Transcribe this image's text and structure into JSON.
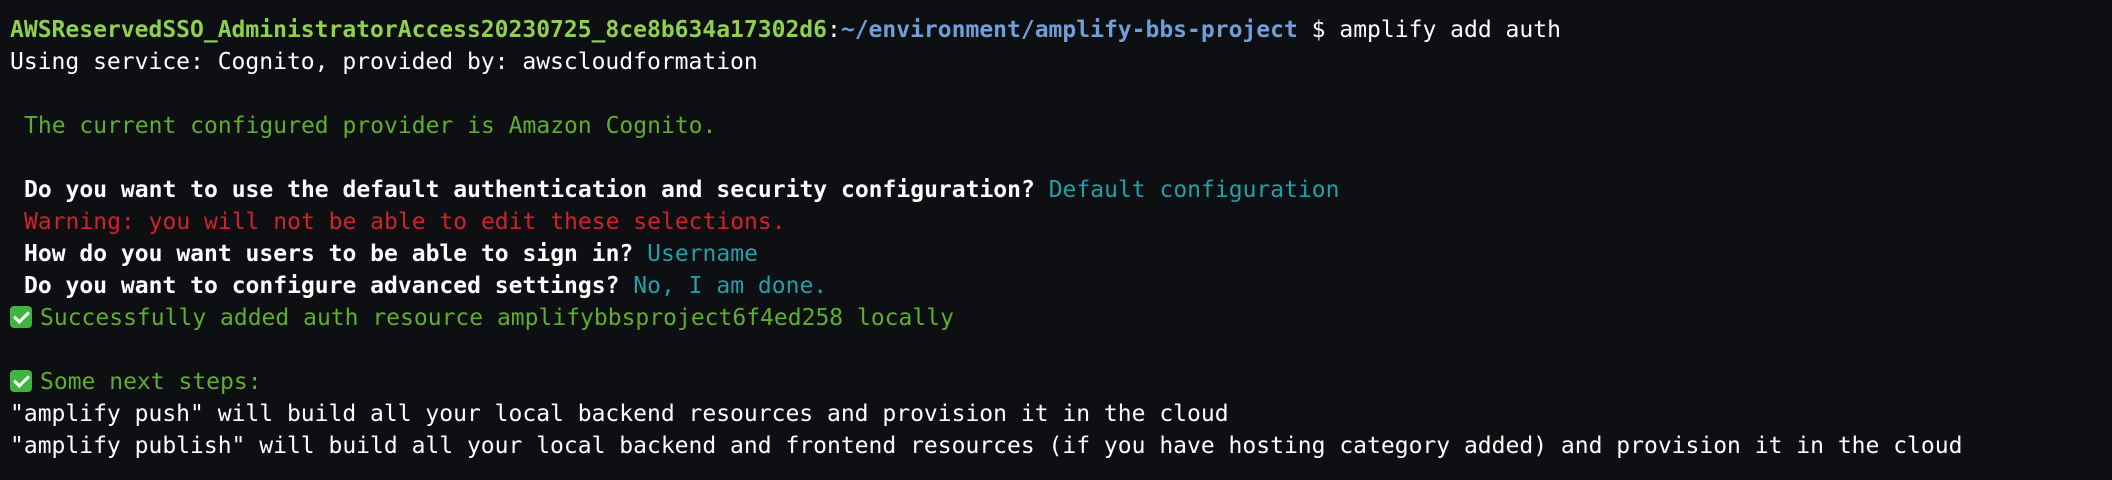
{
  "prompt": {
    "user_host": "AWSReservedSSO_AdministratorAccess20230725_8ce8b634a17302d6",
    "separator": ":",
    "path": "~/environment/amplify-bbs-project",
    "symbol": " $ ",
    "command": "amplify add auth"
  },
  "output": {
    "using_service": "Using service: Cognito, provided by: awscloudformation",
    "current_provider": "The current configured provider is Amazon Cognito.",
    "q1_label": "Do you want to use the default authentication and security configuration?",
    "q1_answer": "Default configuration",
    "warning": "Warning: you will not be able to edit these selections.",
    "q2_label": "How do you want users to be able to sign in?",
    "q2_answer": "Username",
    "q3_label": "Do you want to configure advanced settings?",
    "q3_answer": "No, I am done.",
    "success": "Successfully added auth resource amplifybbsproject6f4ed258 locally",
    "next_steps": "Some next steps:",
    "push_info": "\"amplify push\" will build all your local backend resources and provision it in the cloud",
    "publish_info": "\"amplify publish\" will build all your local backend and frontend resources (if you have hosting category added) and provision it in the cloud"
  },
  "icons": {
    "success_icon": "check-mark-button",
    "next_steps_icon": "check-mark-button"
  },
  "colors": {
    "background": "#0d0f12",
    "prompt_user": "#8fd14f",
    "prompt_path": "#6f9fd8",
    "info_green": "#5fae2f",
    "warning_red": "#d4222a",
    "answer_teal": "#22a0a8"
  }
}
